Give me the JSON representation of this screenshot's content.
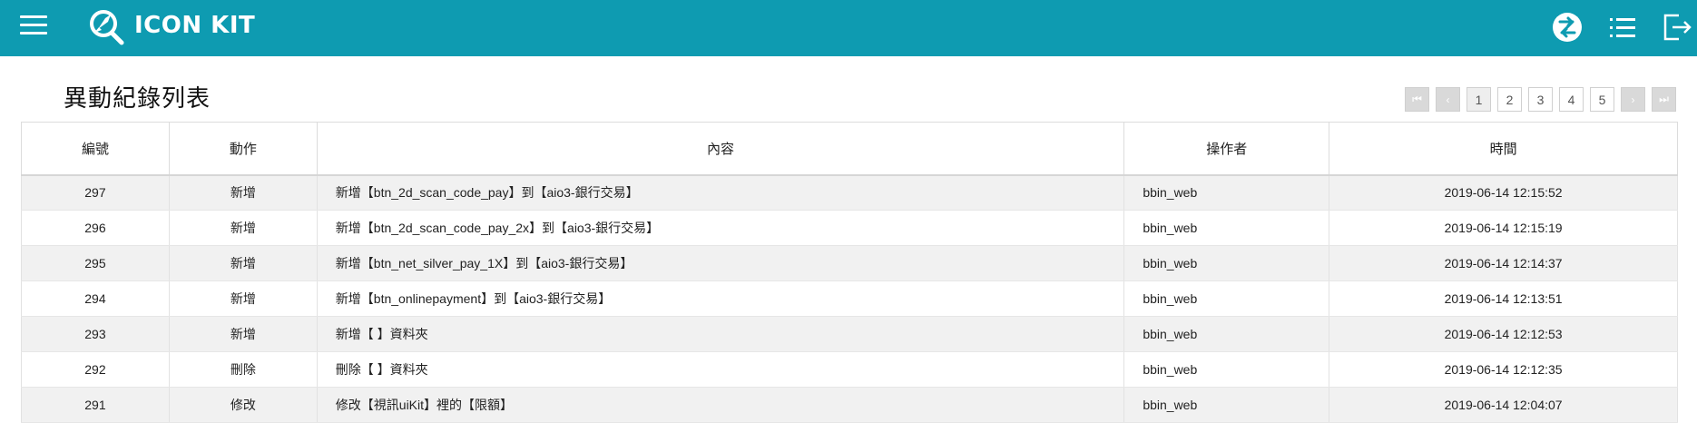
{
  "header": {
    "brand": "ICON KIT",
    "accent_color": "#0e9bb1",
    "icons": [
      "menu-icon",
      "rocket-search-logo-icon",
      "swap-icon",
      "list-icon",
      "logout-icon"
    ]
  },
  "page": {
    "title": "異動紀錄列表"
  },
  "pagination": {
    "first": "first-page-icon",
    "prev": "prev-page-icon",
    "pages": [
      "1",
      "2",
      "3",
      "4",
      "5"
    ],
    "current": "1",
    "next": "next-page-icon",
    "last": "last-page-icon"
  },
  "table": {
    "columns": [
      "編號",
      "動作",
      "內容",
      "操作者",
      "時間"
    ],
    "rows": [
      {
        "no": "297",
        "action": "新增",
        "content": "新增【btn_2d_scan_code_pay】到【aio3-銀行交易】",
        "operator": "bbin_web",
        "time": "2019-06-14 12:15:52"
      },
      {
        "no": "296",
        "action": "新增",
        "content": "新增【btn_2d_scan_code_pay_2x】到【aio3-銀行交易】",
        "operator": "bbin_web",
        "time": "2019-06-14 12:15:19"
      },
      {
        "no": "295",
        "action": "新增",
        "content": "新增【btn_net_silver_pay_1X】到【aio3-銀行交易】",
        "operator": "bbin_web",
        "time": "2019-06-14 12:14:37"
      },
      {
        "no": "294",
        "action": "新增",
        "content": "新增【btn_onlinepayment】到【aio3-銀行交易】",
        "operator": "bbin_web",
        "time": "2019-06-14 12:13:51"
      },
      {
        "no": "293",
        "action": "新增",
        "content": "新增【 】資料夾",
        "operator": "bbin_web",
        "time": "2019-06-14 12:12:53"
      },
      {
        "no": "292",
        "action": "刪除",
        "content": "刪除【 】資料夾",
        "operator": "bbin_web",
        "time": "2019-06-14 12:12:35"
      },
      {
        "no": "291",
        "action": "修改",
        "content": "修改【視訊uiKit】裡的【限額】",
        "operator": "bbin_web",
        "time": "2019-06-14 12:04:07"
      }
    ]
  }
}
